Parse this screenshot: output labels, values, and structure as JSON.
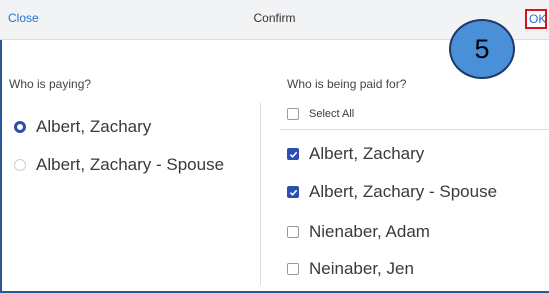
{
  "header": {
    "close_label": "Close",
    "title": "Confirm",
    "ok_label": "OK"
  },
  "step_badge": "5",
  "payer": {
    "heading": "Who is paying?",
    "options": [
      {
        "label": "Albert, Zachary",
        "selected": true
      },
      {
        "label": "Albert, Zachary - Spouse",
        "selected": false
      }
    ]
  },
  "payees": {
    "heading": "Who is being paid for?",
    "select_all_label": "Select All",
    "options": [
      {
        "label": "Albert, Zachary",
        "checked": true
      },
      {
        "label": "Albert, Zachary - Spouse",
        "checked": true
      },
      {
        "label": "Nienaber, Adam",
        "checked": false
      },
      {
        "label": "Neinaber, Jen",
        "checked": false
      }
    ]
  },
  "colors": {
    "link": "#1f73d1",
    "accent": "#2b4fb0",
    "highlight_box": "#e0101a",
    "badge_fill": "#4a90d9"
  }
}
